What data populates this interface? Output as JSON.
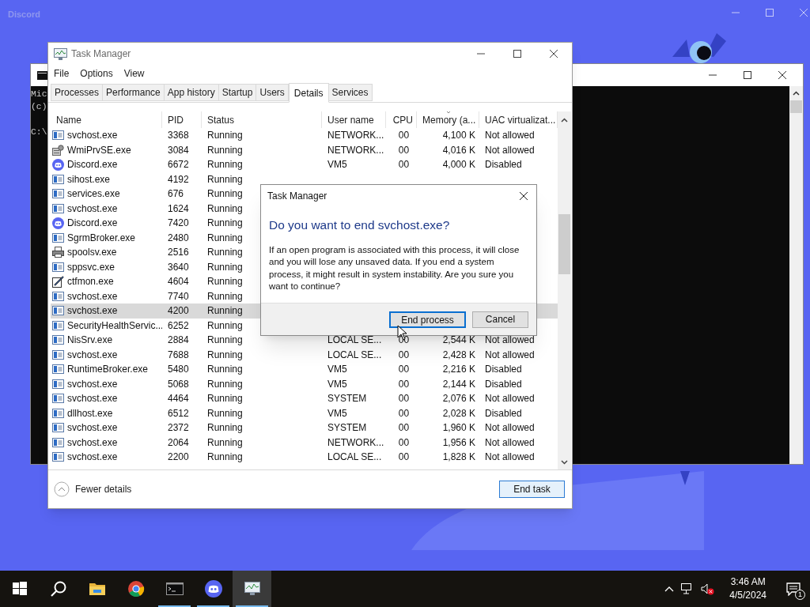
{
  "discord_window": {
    "title": "Discord"
  },
  "console_window": {
    "lines": [
      "Mic",
      "(c)",
      "C:\\"
    ]
  },
  "task_manager": {
    "title": "Task Manager",
    "menu": [
      "File",
      "Options",
      "View"
    ],
    "tabs": [
      {
        "label": "Processes",
        "selected": false
      },
      {
        "label": "Performance",
        "selected": false
      },
      {
        "label": "App history",
        "selected": false
      },
      {
        "label": "Startup",
        "selected": false
      },
      {
        "label": "Users",
        "selected": false
      },
      {
        "label": "Details",
        "selected": true
      },
      {
        "label": "Services",
        "selected": false
      }
    ],
    "table": {
      "columns": [
        "Name",
        "PID",
        "Status",
        "User name",
        "CPU",
        "Memory (a...",
        "UAC virtualizat..."
      ],
      "rows": [
        {
          "kind": "service",
          "name": "svchost.exe",
          "pid": "3368",
          "status": "Running",
          "user_name": "NETWORK...",
          "cpu": "00",
          "memory": "4,100 K",
          "uac": "Not allowed",
          "selected": false
        },
        {
          "kind": "wmi",
          "name": "WmiPrvSE.exe",
          "pid": "3084",
          "status": "Running",
          "user_name": "NETWORK...",
          "cpu": "00",
          "memory": "4,016 K",
          "uac": "Not allowed",
          "selected": false
        },
        {
          "kind": "discord",
          "name": "Discord.exe",
          "pid": "6672",
          "status": "Running",
          "user_name": "VM5",
          "cpu": "00",
          "memory": "4,000 K",
          "uac": "Disabled",
          "selected": false
        },
        {
          "kind": "service",
          "name": "sihost.exe",
          "pid": "4192",
          "status": "Running",
          "selected": false
        },
        {
          "kind": "service",
          "name": "services.exe",
          "pid": "676",
          "status": "Running",
          "selected": false
        },
        {
          "kind": "service",
          "name": "svchost.exe",
          "pid": "1624",
          "status": "Running",
          "selected": false
        },
        {
          "kind": "discord",
          "name": "Discord.exe",
          "pid": "7420",
          "status": "Running",
          "selected": false
        },
        {
          "kind": "service",
          "name": "SgrmBroker.exe",
          "pid": "2480",
          "status": "Running",
          "selected": false
        },
        {
          "kind": "printer",
          "name": "spoolsv.exe",
          "pid": "2516",
          "status": "Running",
          "selected": false
        },
        {
          "kind": "service",
          "name": "sppsvc.exe",
          "pid": "3640",
          "status": "Running",
          "selected": false
        },
        {
          "kind": "pen",
          "name": "ctfmon.exe",
          "pid": "4604",
          "status": "Running",
          "selected": false
        },
        {
          "kind": "service",
          "name": "svchost.exe",
          "pid": "7740",
          "status": "Running",
          "selected": false
        },
        {
          "kind": "service",
          "name": "svchost.exe",
          "pid": "4200",
          "status": "Running",
          "selected": true
        },
        {
          "kind": "service",
          "name": "SecurityHealthServic...",
          "pid": "6252",
          "status": "Running",
          "selected": false
        },
        {
          "kind": "service",
          "name": "NisSrv.exe",
          "pid": "2884",
          "status": "Running",
          "user_name": "LOCAL SE...",
          "cpu": "00",
          "memory": "2,544 K",
          "uac": "Not allowed",
          "selected": false
        },
        {
          "kind": "service",
          "name": "svchost.exe",
          "pid": "7688",
          "status": "Running",
          "user_name": "LOCAL SE...",
          "cpu": "00",
          "memory": "2,428 K",
          "uac": "Not allowed",
          "selected": false
        },
        {
          "kind": "service",
          "name": "RuntimeBroker.exe",
          "pid": "5480",
          "status": "Running",
          "user_name": "VM5",
          "cpu": "00",
          "memory": "2,216 K",
          "uac": "Disabled",
          "selected": false
        },
        {
          "kind": "service",
          "name": "svchost.exe",
          "pid": "5068",
          "status": "Running",
          "user_name": "VM5",
          "cpu": "00",
          "memory": "2,144 K",
          "uac": "Disabled",
          "selected": false
        },
        {
          "kind": "service",
          "name": "svchost.exe",
          "pid": "4464",
          "status": "Running",
          "user_name": "SYSTEM",
          "cpu": "00",
          "memory": "2,076 K",
          "uac": "Not allowed",
          "selected": false
        },
        {
          "kind": "service",
          "name": "dllhost.exe",
          "pid": "6512",
          "status": "Running",
          "user_name": "VM5",
          "cpu": "00",
          "memory": "2,028 K",
          "uac": "Disabled",
          "selected": false
        },
        {
          "kind": "service",
          "name": "svchost.exe",
          "pid": "2372",
          "status": "Running",
          "user_name": "SYSTEM",
          "cpu": "00",
          "memory": "1,960 K",
          "uac": "Not allowed",
          "selected": false
        },
        {
          "kind": "service",
          "name": "svchost.exe",
          "pid": "2064",
          "status": "Running",
          "user_name": "NETWORK...",
          "cpu": "00",
          "memory": "1,956 K",
          "uac": "Not allowed",
          "selected": false
        },
        {
          "kind": "service",
          "name": "svchost.exe",
          "pid": "2200",
          "status": "Running",
          "user_name": "LOCAL SE...",
          "cpu": "00",
          "memory": "1,828 K",
          "uac": "Not allowed",
          "selected": false
        }
      ]
    },
    "footer": {
      "toggle": "Fewer details",
      "button": "End task"
    }
  },
  "dialog": {
    "title": "Task Manager",
    "heading": "Do you want to end svchost.exe?",
    "message": "If an open program is associated with this process, it will close and you will lose any unsaved data. If you end a system process, it might result in system instability. Are you sure you want to continue?",
    "buttons": [
      {
        "label": "End process",
        "focused": true
      },
      {
        "label": "Cancel",
        "focused": false
      }
    ]
  },
  "taskbar": {
    "apps": [
      {
        "kind": "start",
        "running": false,
        "active": false
      },
      {
        "kind": "search",
        "running": false,
        "active": false
      },
      {
        "kind": "folder",
        "running": false,
        "active": false
      },
      {
        "kind": "browser",
        "running": false,
        "active": false
      },
      {
        "kind": "terminal",
        "running": true,
        "active": false
      },
      {
        "kind": "discord",
        "running": true,
        "active": false
      },
      {
        "kind": "taskmgr",
        "running": true,
        "active": true
      }
    ],
    "time": "3:46 AM",
    "date": "4/5/2024",
    "notification_count": "1"
  }
}
